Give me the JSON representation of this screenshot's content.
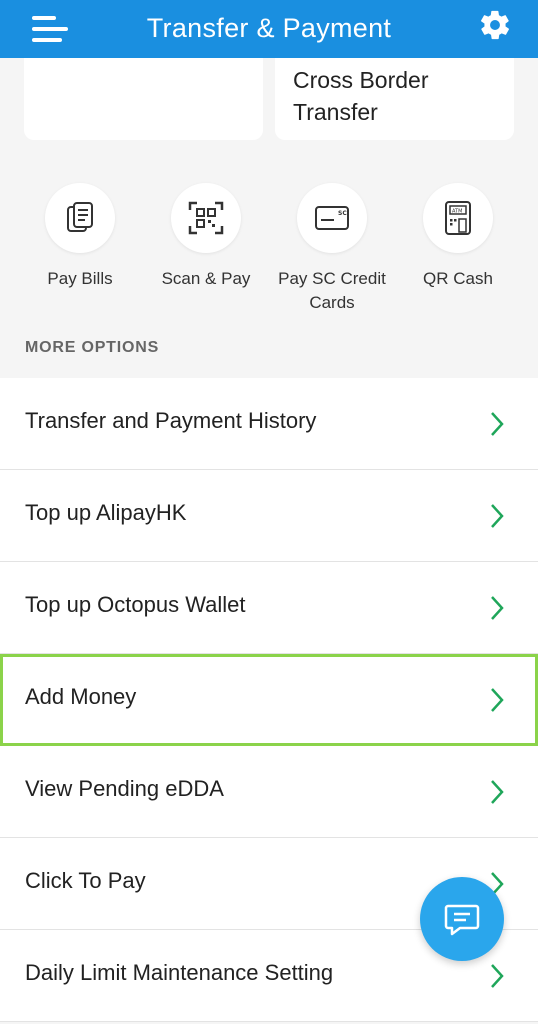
{
  "header": {
    "title": "Transfer & Payment",
    "menu_icon": "hamburger-menu-icon",
    "settings_icon": "gear-icon",
    "color": "#1a8fe0"
  },
  "cards": {
    "left": {
      "label": ""
    },
    "right": {
      "label": "Cross Border Transfer"
    }
  },
  "quick_actions": [
    {
      "label": "Pay Bills",
      "icon": "bill-document-icon"
    },
    {
      "label": "Scan & Pay",
      "icon": "qr-scan-icon"
    },
    {
      "label": "Pay SC Credit Cards",
      "icon": "credit-card-icon"
    },
    {
      "label": "QR Cash",
      "icon": "atm-icon"
    }
  ],
  "more_options": {
    "title": "MORE OPTIONS",
    "items": [
      {
        "label": "Transfer and Payment History"
      },
      {
        "label": "Top up AlipayHK"
      },
      {
        "label": "Top up Octopus Wallet"
      },
      {
        "label": "Add Money"
      },
      {
        "label": "View Pending eDDA"
      },
      {
        "label": "Click To Pay"
      },
      {
        "label": "Daily Limit Maintenance Setting"
      }
    ],
    "chevron_color": "#1fa65a",
    "highlight_color": "#8bd34a"
  },
  "chat_button": {
    "icon": "chat-bubble-icon",
    "color": "#2aa6ec"
  }
}
